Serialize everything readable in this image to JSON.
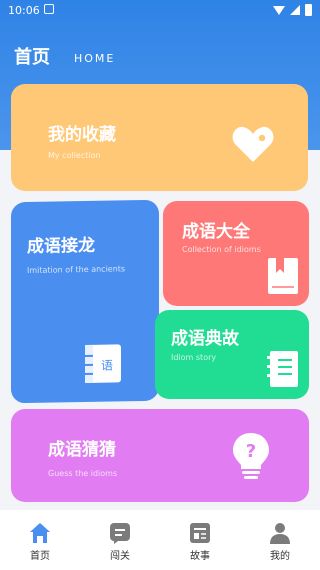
{
  "status_bar": {
    "time": "10:06"
  },
  "header": {
    "title": "首页",
    "subtitle": "HOME"
  },
  "cards": {
    "collection": {
      "title": "我的收藏",
      "subtitle": "My collection",
      "color": "#ffc877"
    },
    "solitaire": {
      "title": "成语接龙",
      "subtitle": "Imitation of the ancients",
      "color": "#4a8ff0",
      "icon_text": "语"
    },
    "daquan": {
      "title": "成语大全",
      "subtitle": "Collection of idioms",
      "color": "#ff7878"
    },
    "diangu": {
      "title": "成语典故",
      "subtitle": "Idiom story",
      "color": "#20dd93"
    },
    "guess": {
      "title": "成语猜猜",
      "subtitle": "Guess the idioms",
      "color": "#e17cf2",
      "icon_text": "?"
    }
  },
  "tabbar": {
    "tabs": [
      {
        "label": "首页",
        "icon": "home-icon",
        "active": true
      },
      {
        "label": "闯关",
        "icon": "level-icon",
        "active": false
      },
      {
        "label": "故事",
        "icon": "story-icon",
        "active": false
      },
      {
        "label": "我的",
        "icon": "profile-icon",
        "active": false
      }
    ]
  },
  "colors": {
    "header": "#2f83e6",
    "tab_active": "#4a8ff0",
    "tab_inactive": "#7b7b7b"
  }
}
